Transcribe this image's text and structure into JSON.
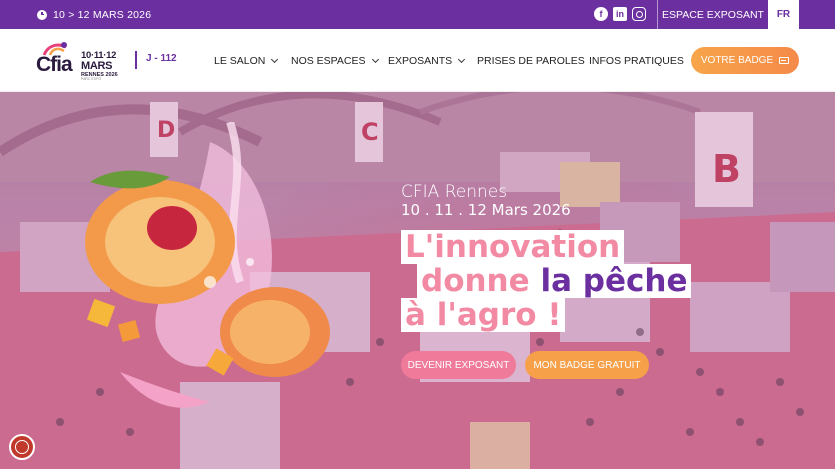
{
  "topbar": {
    "date": "10 > 12 MARS 2026",
    "espace_exposant": "ESPACE EXPOSANT",
    "lang": "FR",
    "socials": [
      "facebook-icon",
      "linkedin-icon",
      "instagram-icon"
    ]
  },
  "header": {
    "logo": {
      "name": "Cfia",
      "dates_line1": "10·11·12",
      "dates_line2": "MARS",
      "dates_line3": "RENNES 2026",
      "dates_line4": "PARC EXPO"
    },
    "countdown": "J - 112",
    "nav": [
      {
        "label": "LE SALON",
        "dropdown": true
      },
      {
        "label": "NOS ESPACES",
        "dropdown": true
      },
      {
        "label": "EXPOSANTS",
        "dropdown": true
      },
      {
        "label": "PRISES DE PAROLES",
        "dropdown": false
      },
      {
        "label": "INFOS PRATIQUES",
        "dropdown": false
      }
    ],
    "badge_button": "VOTRE BADGE"
  },
  "hero": {
    "subtitle": "CFIA Rennes",
    "dates": "10 . 11 . 12 Mars 2026",
    "headline_line1": "L'innovation",
    "headline_line2a": "donne ",
    "headline_line2b": "la pêche",
    "headline_line3": "à l'agro !",
    "cta_exposant": "DEVENIR EXPOSANT",
    "cta_badge": "MON BADGE GRATUIT"
  },
  "colors": {
    "primary": "#6b2fa0",
    "accent_orange": "#f6a04a",
    "accent_pink": "#ef7a9a"
  }
}
